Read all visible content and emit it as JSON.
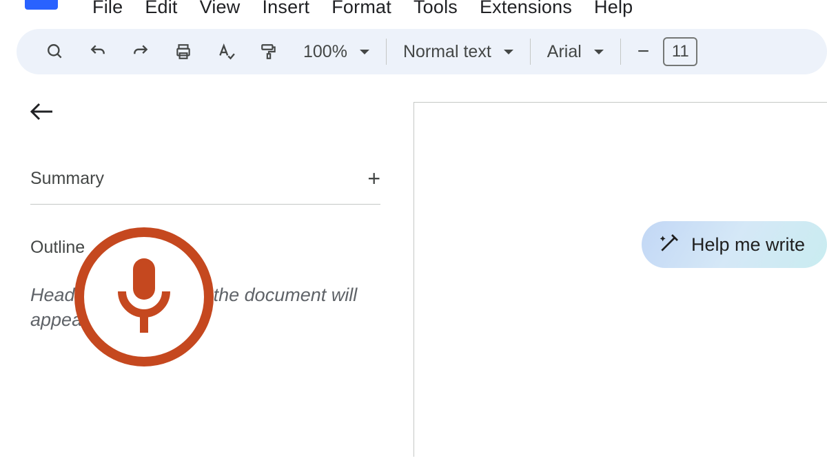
{
  "menu": {
    "file": "File",
    "edit": "Edit",
    "view": "View",
    "insert": "Insert",
    "format": "Format",
    "tools": "Tools",
    "extensions": "Extensions",
    "help": "Help"
  },
  "toolbar": {
    "zoom": "100%",
    "style": "Normal text",
    "font": "Arial",
    "font_size": "11"
  },
  "sidebar": {
    "summary_label": "Summary",
    "outline_label": "Outline",
    "outline_placeholder_pre": "Heading",
    "outline_placeholder_post": "the document will appear here."
  },
  "help_write": {
    "label": "Help me write"
  }
}
